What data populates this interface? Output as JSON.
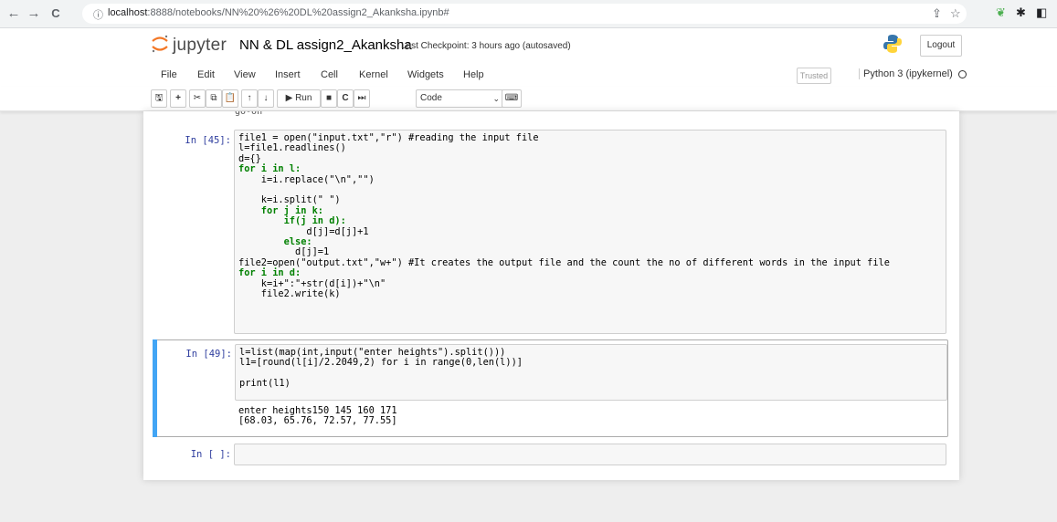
{
  "browser": {
    "back": "←",
    "forward": "→",
    "reload": "C",
    "url_host": "localhost",
    "url_path": ":8888/notebooks/NN%20%26%20DL%20assign2_Akanksha.ipynb#"
  },
  "header": {
    "brand": "jupyter",
    "notebook_name": "NN & DL assign2_Akanksha",
    "checkpoint": "Last Checkpoint: 3 hours ago  (autosaved)",
    "logout_label": "Logout"
  },
  "menu": {
    "items": [
      "File",
      "Edit",
      "View",
      "Insert",
      "Cell",
      "Kernel",
      "Widgets",
      "Help"
    ],
    "trusted_label": "Trusted",
    "kernel_label": "Python 3 (ipykernel)"
  },
  "toolbar": {
    "run_label": "Run",
    "cell_type": "Code"
  },
  "cells": [
    {
      "prompt": "In [45]:",
      "lines": [
        "file1 = open(\"input.txt\",\"r\") #reading the input file",
        "l=file1.readlines()",
        "d={}",
        "for i in l:",
        "    i=i.replace(\"\\n\",\"\")",
        "",
        "    k=i.split(\" \")",
        "    for j in k:",
        "        if(j in d):",
        "            d[j]=d[j]+1",
        "        else:",
        "          d[j]=1",
        "file2=open(\"output.txt\",\"w+\") #It creates the output file and the count the no of different words in the input file",
        "for i in d:",
        "    k=i+\":\"+str(d[i])+\"\\n\"",
        "    file2.write(k)"
      ]
    },
    {
      "prompt": "In [49]:",
      "lines": [
        "l=list(map(int,input(\"enter heights\").split()))",
        "l1=[round(l[i]/2.2049,2) for i in range(0,len(l))]",
        "",
        "print(l1)"
      ],
      "output": [
        "enter heights150 145 160 171",
        "[68.03, 65.76, 72.57, 77.55]"
      ]
    },
    {
      "prompt": "In [ ]:",
      "lines": [
        ""
      ]
    }
  ],
  "colors": {
    "prompt": "#303f9f",
    "selected_bar": "#42a5f5",
    "keyword": "#008000",
    "string": "#ba2121",
    "comment": "#408080"
  }
}
